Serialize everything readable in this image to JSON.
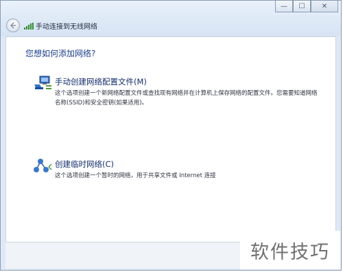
{
  "window": {
    "title": "手动连接到无线网络",
    "controls": {
      "minimize": "—",
      "maximize": "☐",
      "close": "✕"
    }
  },
  "content": {
    "heading": "您想如何添加网络?",
    "options": [
      {
        "title": "手动创建网络配置文件(M)",
        "desc": "这个选项创建一个新网络配置文件或查找现有网络并在计算机上保存网络的配置文件。您需要知道网络名称(SSID)和安全密钥(如果适用)。",
        "icon": "network-profile-icon"
      },
      {
        "title": "创建临时网络(C)",
        "desc": "这个选项创建一个暂时的网络，用于共享文件或 Internet 连接",
        "icon": "adhoc-network-icon"
      }
    ]
  },
  "watermark": "软件技巧"
}
